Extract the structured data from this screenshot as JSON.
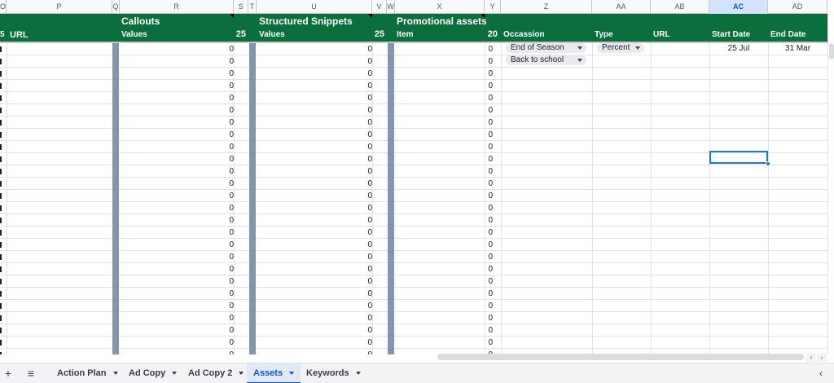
{
  "column_headers": [
    "P",
    "Q",
    "R",
    "S",
    "T",
    "U",
    "V",
    "W",
    "X",
    "Y",
    "Z",
    "AA",
    "AB",
    "AC",
    "AD"
  ],
  "selected_column": "AC",
  "header": {
    "first_col_fragment": "5",
    "url_label": "URL",
    "callouts_title": "Callouts",
    "callouts_values_label": "Values",
    "callouts_count": "25",
    "snippets_title": "Structured Snippets",
    "snippets_values_label": "Values",
    "snippets_count": "25",
    "promo_title": "Promotional assets",
    "promo_item_label": "Item",
    "promo_count": "20",
    "occassion_label": "Occassion",
    "type_label": "Type",
    "promo_url_label": "URL",
    "start_date_label": "Start Date",
    "end_date_label": "End Date"
  },
  "rows": {
    "zero_value": "0",
    "occassion_chips": [
      "End of Season",
      "Back to school"
    ],
    "type_chip": "Percent",
    "start_date": "25 Jul",
    "end_date": "31 Mar"
  },
  "sheet_tabs": [
    {
      "label": "Action Plan",
      "active": false
    },
    {
      "label": "Ad Copy",
      "active": false
    },
    {
      "label": "Ad Copy 2",
      "active": false
    },
    {
      "label": "Assets",
      "active": true
    },
    {
      "label": "Keywords",
      "active": false
    }
  ],
  "icons": {
    "add_sheet": "+",
    "all_sheets": "≡",
    "collapse": "‹",
    "scroll_left": "‹",
    "scroll_right": "›"
  },
  "colors": {
    "header_green": "#0b6e3d",
    "separator_blue_gray": "#8495ad",
    "selection_blue": "#1a73e8"
  }
}
